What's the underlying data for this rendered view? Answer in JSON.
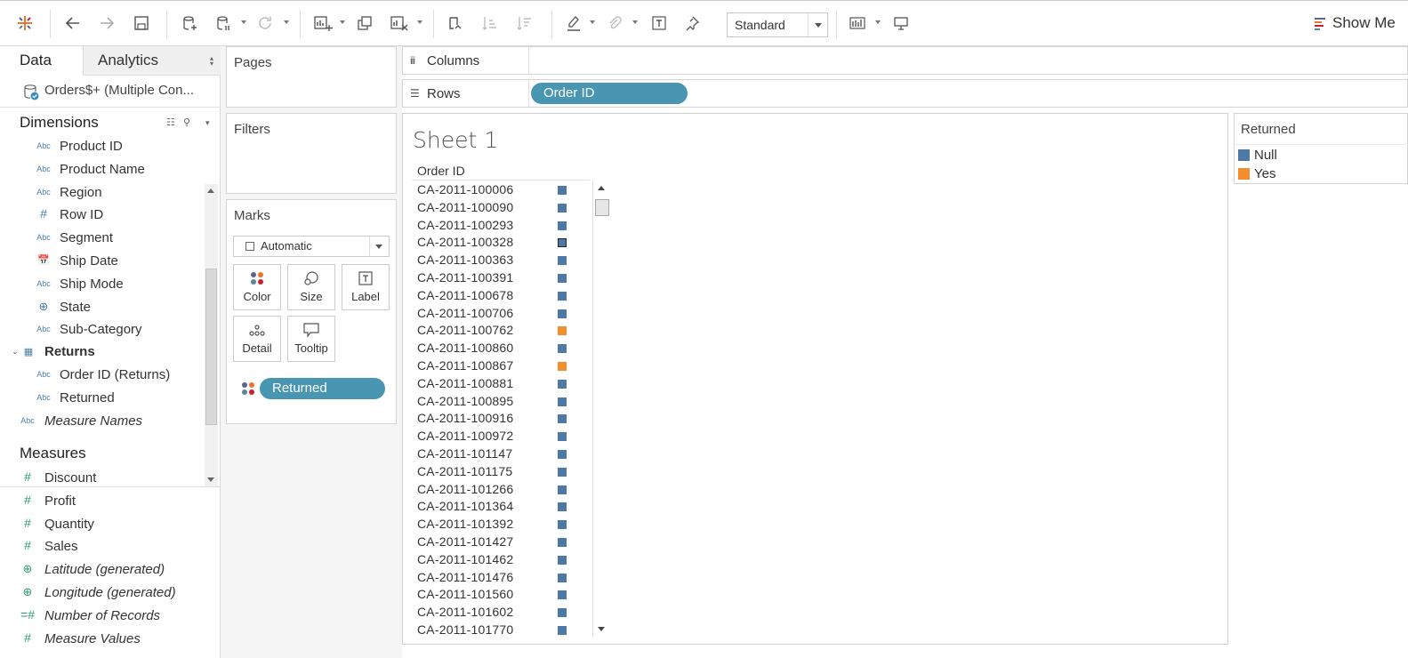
{
  "toolbar": {
    "standard_label": "Standard",
    "show_me_label": "Show Me"
  },
  "data_pane": {
    "tab_data": "Data",
    "tab_analytics": "Analytics",
    "datasource": "Orders$+ (Multiple Con...",
    "dimensions_header": "Dimensions",
    "measures_header": "Measures",
    "dimensions": [
      {
        "label": "Product ID",
        "type": "Abc"
      },
      {
        "label": "Product Name",
        "type": "Abc"
      },
      {
        "label": "Region",
        "type": "Abc"
      },
      {
        "label": "Row ID",
        "type": "#"
      },
      {
        "label": "Segment",
        "type": "Abc"
      },
      {
        "label": "Ship Date",
        "type": "date"
      },
      {
        "label": "Ship Mode",
        "type": "Abc"
      },
      {
        "label": "State",
        "type": "geo"
      },
      {
        "label": "Sub-Category",
        "type": "Abc"
      }
    ],
    "returns_group": "Returns",
    "returns_fields": [
      {
        "label": "Order ID (Returns)",
        "type": "Abc"
      },
      {
        "label": "Returned",
        "type": "Abc"
      }
    ],
    "measure_names": "Measure Names",
    "measures": [
      {
        "label": "Discount",
        "type": "#",
        "italic": false
      },
      {
        "label": "Profit",
        "type": "#",
        "italic": false
      },
      {
        "label": "Quantity",
        "type": "#",
        "italic": false
      },
      {
        "label": "Sales",
        "type": "#",
        "italic": false
      },
      {
        "label": "Latitude (generated)",
        "type": "geo",
        "italic": true
      },
      {
        "label": "Longitude (generated)",
        "type": "geo",
        "italic": true
      },
      {
        "label": "Number of Records",
        "type": "=#",
        "italic": true
      },
      {
        "label": "Measure Values",
        "type": "#",
        "italic": true
      }
    ]
  },
  "cards": {
    "pages": "Pages",
    "filters": "Filters",
    "marks": "Marks",
    "mark_type": "Automatic",
    "buttons": {
      "color": "Color",
      "size": "Size",
      "label": "Label",
      "detail": "Detail",
      "tooltip": "Tooltip"
    },
    "color_pill": "Returned"
  },
  "shelves": {
    "columns": "Columns",
    "rows": "Rows",
    "rows_pill": "Order ID"
  },
  "sheet": {
    "title": "Sheet 1",
    "column_header": "Order ID",
    "rows": [
      {
        "id": "CA-2011-100006",
        "returned": "Null"
      },
      {
        "id": "CA-2011-100090",
        "returned": "Null"
      },
      {
        "id": "CA-2011-100293",
        "returned": "Null"
      },
      {
        "id": "CA-2011-100328",
        "returned": "Null",
        "selected": true
      },
      {
        "id": "CA-2011-100363",
        "returned": "Null"
      },
      {
        "id": "CA-2011-100391",
        "returned": "Null"
      },
      {
        "id": "CA-2011-100678",
        "returned": "Null"
      },
      {
        "id": "CA-2011-100706",
        "returned": "Null"
      },
      {
        "id": "CA-2011-100762",
        "returned": "Yes"
      },
      {
        "id": "CA-2011-100860",
        "returned": "Null"
      },
      {
        "id": "CA-2011-100867",
        "returned": "Yes"
      },
      {
        "id": "CA-2011-100881",
        "returned": "Null"
      },
      {
        "id": "CA-2011-100895",
        "returned": "Null"
      },
      {
        "id": "CA-2011-100916",
        "returned": "Null"
      },
      {
        "id": "CA-2011-100972",
        "returned": "Null"
      },
      {
        "id": "CA-2011-101147",
        "returned": "Null"
      },
      {
        "id": "CA-2011-101175",
        "returned": "Null"
      },
      {
        "id": "CA-2011-101266",
        "returned": "Null"
      },
      {
        "id": "CA-2011-101364",
        "returned": "Null"
      },
      {
        "id": "CA-2011-101392",
        "returned": "Null"
      },
      {
        "id": "CA-2011-101427",
        "returned": "Null"
      },
      {
        "id": "CA-2011-101462",
        "returned": "Null"
      },
      {
        "id": "CA-2011-101476",
        "returned": "Null"
      },
      {
        "id": "CA-2011-101560",
        "returned": "Null"
      },
      {
        "id": "CA-2011-101602",
        "returned": "Null"
      },
      {
        "id": "CA-2011-101770",
        "returned": "Null"
      }
    ]
  },
  "legend": {
    "title": "Returned",
    "items": [
      {
        "label": "Null",
        "color": "#4e79a7"
      },
      {
        "label": "Yes",
        "color": "#f28e2b"
      }
    ]
  },
  "colors": {
    "pill": "#4996b2",
    "null": "#4e79a7",
    "yes": "#f28e2b"
  }
}
